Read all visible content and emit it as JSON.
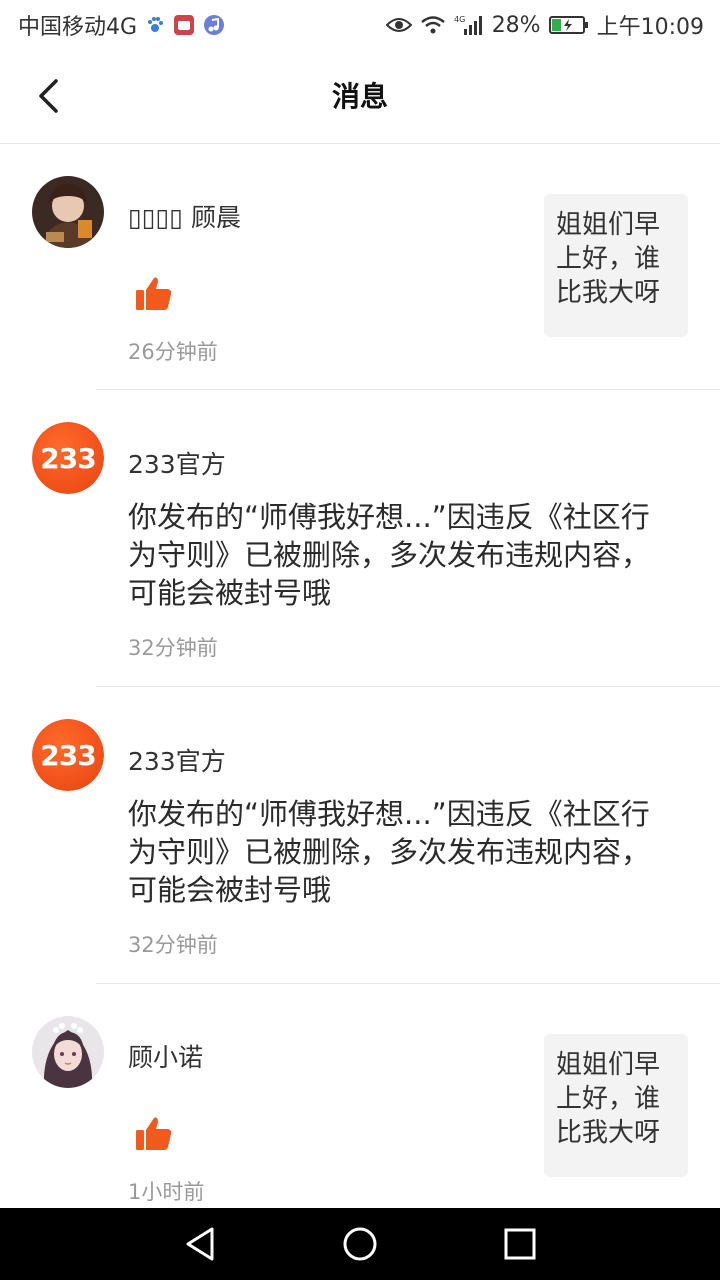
{
  "status": {
    "carrier": "中国移动4G",
    "battery": "28%",
    "time": "上午10:09",
    "icons": [
      "paw-icon",
      "app-icon",
      "music-icon",
      "eye-icon",
      "wifi-icon",
      "signal-icon",
      "battery-icon"
    ]
  },
  "header": {
    "title": "消息",
    "back_icon": "chevron-left-icon"
  },
  "messages": [
    {
      "name": "▯▯▯▯ 顾晨",
      "type": "like",
      "time": "26分钟前",
      "quote": "姐姐们早上好，谁比我大呀"
    },
    {
      "name": "233官方",
      "type": "notice",
      "text": "你发布的“师傅我好想...”因违反《社区行为守则》已被删除，多次发布违规内容，可能会被封号哦",
      "time": "32分钟前",
      "logo": "233"
    },
    {
      "name": "233官方",
      "type": "notice",
      "text": "你发布的“师傅我好想...”因违反《社区行为守则》已被删除，多次发布违规内容，可能会被封号哦",
      "time": "32分钟前",
      "logo": "233"
    },
    {
      "name": "顾小诺",
      "type": "like",
      "time": "1小时前",
      "quote": "姐姐们早上好，谁比我大呀"
    }
  ],
  "colors": {
    "accent": "#f2521b",
    "like": "#f25a1d"
  }
}
